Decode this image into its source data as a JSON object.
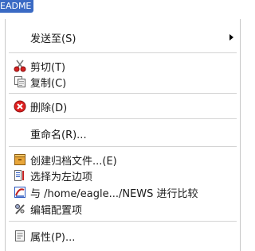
{
  "file_tab": {
    "label": "EADME"
  },
  "menu": {
    "send_to": "发送至(S)",
    "cut": "剪切(T)",
    "copy": "复制(C)",
    "delete": "删除(D)",
    "rename": "重命名(R)...",
    "create_archive": "创建归档文件...(E)",
    "select_left": "选择为左边项",
    "compare_with": "与 /home/eagle.../NEWS 进行比较",
    "edit_config": "编辑配置项",
    "properties": "属性(P)..."
  }
}
